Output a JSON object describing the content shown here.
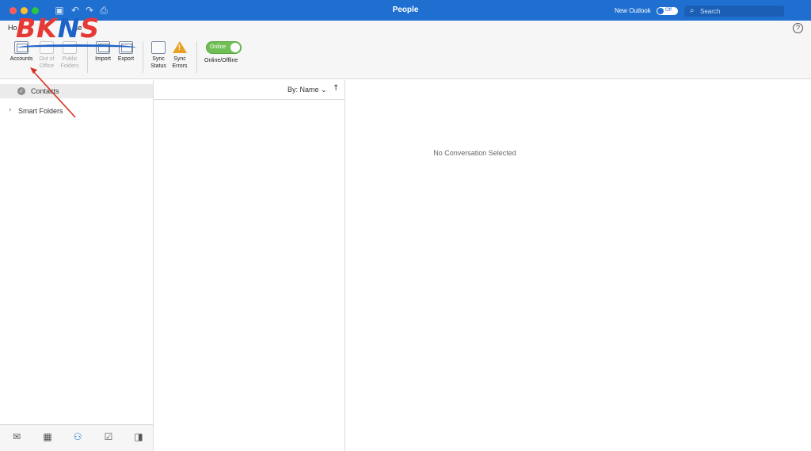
{
  "titlebar": {
    "title": "People",
    "new_outlook_label": "New Outlook",
    "new_outlook_state": "Off",
    "search_placeholder": "Search"
  },
  "ribbon": {
    "tabs": [
      "Ho",
      "se"
    ],
    "buttons": {
      "accounts": "Accounts",
      "out_of_office_1": "Out of",
      "out_of_office_2": "Office",
      "public_folders_1": "Public",
      "public_folders_2": "Folders",
      "import": "Import",
      "export": "Export",
      "sync_status_1": "Sync",
      "sync_status_2": "Status",
      "sync_errors_1": "Sync",
      "sync_errors_2": "Errors"
    },
    "online_toggle_label": "Online",
    "online_offline_label": "Online/Offline",
    "help_glyph": "?"
  },
  "watermark": {
    "logo_text_1": "BK",
    "logo_text_2": "N",
    "logo_text_3": "S"
  },
  "sidebar": {
    "contacts": "Contacts",
    "smart_folders": "Smart Folders"
  },
  "list": {
    "sort_label": "By: Name ⌄",
    "sort_direction_glyph": "↑"
  },
  "reading": {
    "empty_message": "No Conversation Selected"
  },
  "colors": {
    "titlebar": "#1f6fd1",
    "online_toggle": "#6fbf55",
    "annotation_arrow": "#d93025"
  },
  "icons": {
    "bottom_nav": [
      "mail-icon",
      "calendar-icon",
      "people-icon",
      "tasks-icon",
      "notes-icon"
    ]
  }
}
